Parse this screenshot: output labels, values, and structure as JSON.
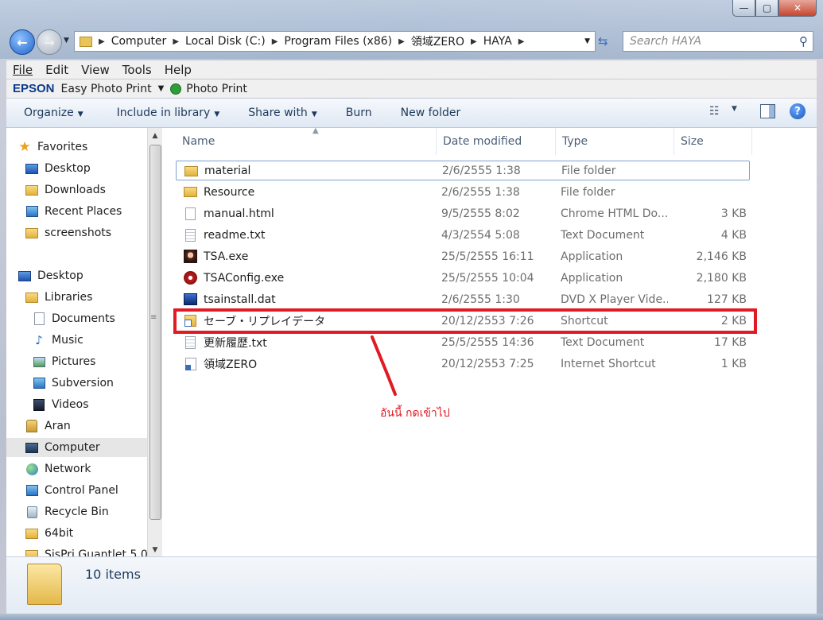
{
  "window": {
    "caption_buttons": {
      "minimize": "—",
      "maximize": "▢",
      "close": "✕"
    }
  },
  "addressbar": {
    "crumbs": [
      "Computer",
      "Local Disk (C:)",
      "Program Files (x86)",
      "領域ZERO",
      "HAYA"
    ],
    "search_placeholder": "Search HAYA"
  },
  "menu": {
    "file": "File",
    "edit": "Edit",
    "view": "View",
    "tools": "Tools",
    "help": "Help"
  },
  "epson": {
    "logo": "EPSON",
    "app": "Easy Photo Print",
    "photo_print": "Photo Print"
  },
  "commands": {
    "organize": "Organize",
    "include": "Include in library",
    "share": "Share with",
    "burn": "Burn",
    "new_folder": "New folder"
  },
  "nav": {
    "items": [
      {
        "label": "Favorites",
        "icon": "star-icon"
      },
      {
        "label": "Desktop",
        "icon": "desktop-icon"
      },
      {
        "label": "Downloads",
        "icon": "downloads-folder-icon"
      },
      {
        "label": "Recent Places",
        "icon": "recent-places-icon"
      },
      {
        "label": "screenshots",
        "icon": "folder-icon"
      },
      {
        "label": "Desktop",
        "icon": "desktop-icon"
      },
      {
        "label": "Libraries",
        "icon": "libraries-icon"
      },
      {
        "label": "Documents",
        "icon": "documents-icon"
      },
      {
        "label": "Music",
        "icon": "music-icon"
      },
      {
        "label": "Pictures",
        "icon": "pictures-icon"
      },
      {
        "label": "Subversion",
        "icon": "subversion-icon"
      },
      {
        "label": "Videos",
        "icon": "videos-icon"
      },
      {
        "label": "Aran",
        "icon": "user-folder-icon"
      },
      {
        "label": "Computer",
        "icon": "computer-icon"
      },
      {
        "label": "Network",
        "icon": "network-icon"
      },
      {
        "label": "Control Panel",
        "icon": "control-panel-icon"
      },
      {
        "label": "Recycle Bin",
        "icon": "recycle-bin-icon"
      },
      {
        "label": "64bit",
        "icon": "folder-icon"
      },
      {
        "label": "SisPri Guantlet 5.0",
        "icon": "folder-icon"
      }
    ]
  },
  "columns": {
    "name": "Name",
    "date": "Date modified",
    "type": "Type",
    "size": "Size"
  },
  "files": [
    {
      "name": "material",
      "date": "2/6/2555 1:38",
      "type": "File folder",
      "size": "",
      "icon": "folder-icon"
    },
    {
      "name": "Resource",
      "date": "2/6/2555 1:38",
      "type": "File folder",
      "size": "",
      "icon": "folder-icon"
    },
    {
      "name": "manual.html",
      "date": "9/5/2555 8:02",
      "type": "Chrome HTML Do...",
      "size": "3 KB",
      "icon": "html-file-icon"
    },
    {
      "name": "readme.txt",
      "date": "4/3/2554 5:08",
      "type": "Text Document",
      "size": "4 KB",
      "icon": "text-file-icon"
    },
    {
      "name": "TSA.exe",
      "date": "25/5/2555 16:11",
      "type": "Application",
      "size": "2,146 KB",
      "icon": "tsa-app-icon"
    },
    {
      "name": "TSAConfig.exe",
      "date": "25/5/2555 10:04",
      "type": "Application",
      "size": "2,180 KB",
      "icon": "config-app-icon"
    },
    {
      "name": "tsainstall.dat",
      "date": "2/6/2555 1:30",
      "type": "DVD X Player Vide...",
      "size": "127 KB",
      "icon": "dvd-video-icon"
    },
    {
      "name": "セーブ・リプレイデータ",
      "date": "20/12/2553 7:26",
      "type": "Shortcut",
      "size": "2 KB",
      "icon": "shortcut-icon"
    },
    {
      "name": "更新履歴.txt",
      "date": "25/5/2555 14:36",
      "type": "Text Document",
      "size": "17 KB",
      "icon": "text-file-icon"
    },
    {
      "name": "領域ZERO",
      "date": "20/12/2553 7:25",
      "type": "Internet Shortcut",
      "size": "1 KB",
      "icon": "internet-shortcut-icon"
    }
  ],
  "annotation": {
    "text": "อันนี้ กดเข้าไป",
    "color": "#e01b24"
  },
  "status": {
    "item_count": "10 items"
  }
}
